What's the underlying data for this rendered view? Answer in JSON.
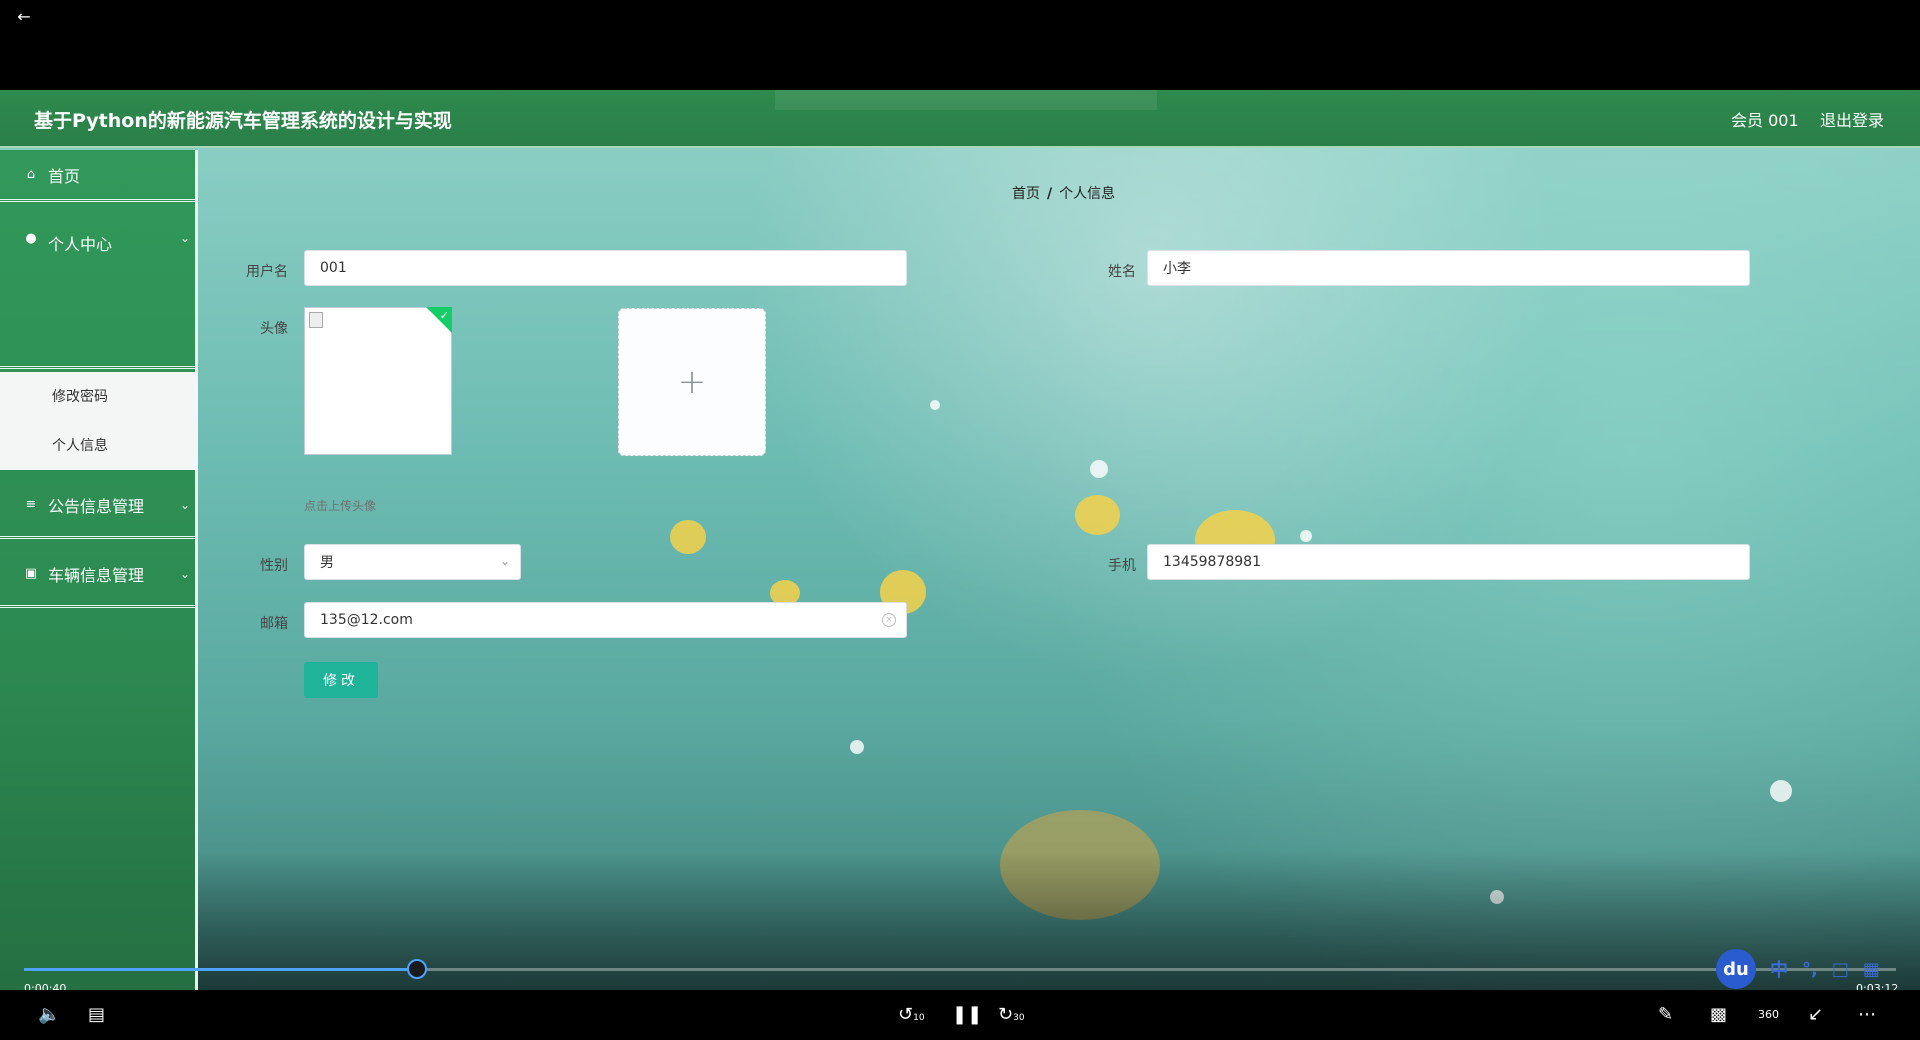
{
  "player": {
    "back_icon": "back-arrow-icon",
    "current_time": "0:00:40",
    "total_time": "0:03:12",
    "progress": 0.21,
    "rewind_label": "10",
    "forward_label": "30",
    "vr_label": "360",
    "accent": "#4da3ff"
  },
  "app": {
    "title": "基于Python的新能源汽车管理系统的设计与实现",
    "member": "会员 001",
    "logout": "退出登录",
    "header_color": "#2e8a4d"
  },
  "sidebar": {
    "items": [
      {
        "label": "首页",
        "icon": "home-icon"
      },
      {
        "label": "个人中心",
        "icon": "user-icon"
      },
      {
        "label": "公告信息管理",
        "icon": "list-icon"
      },
      {
        "label": "车辆信息管理",
        "icon": "briefcase-icon"
      }
    ],
    "personal_center_sub": [
      "修改密码",
      "个人信息"
    ]
  },
  "breadcrumb": {
    "home": "首页",
    "sep": "/",
    "current": "个人信息"
  },
  "form": {
    "username_label": "用户名",
    "username": "001",
    "name_label": "姓名",
    "name": "小李",
    "avatar_label": "头像",
    "upload_tip": "点击上传头像",
    "gender_label": "性别",
    "gender": "男",
    "phone_label": "手机",
    "phone": "13459878981",
    "email_label": "邮箱",
    "email": "135@12.com",
    "submit": "修改",
    "submit_color": "#1fb39a"
  },
  "ime": {
    "brand": "du",
    "mode": "中"
  }
}
